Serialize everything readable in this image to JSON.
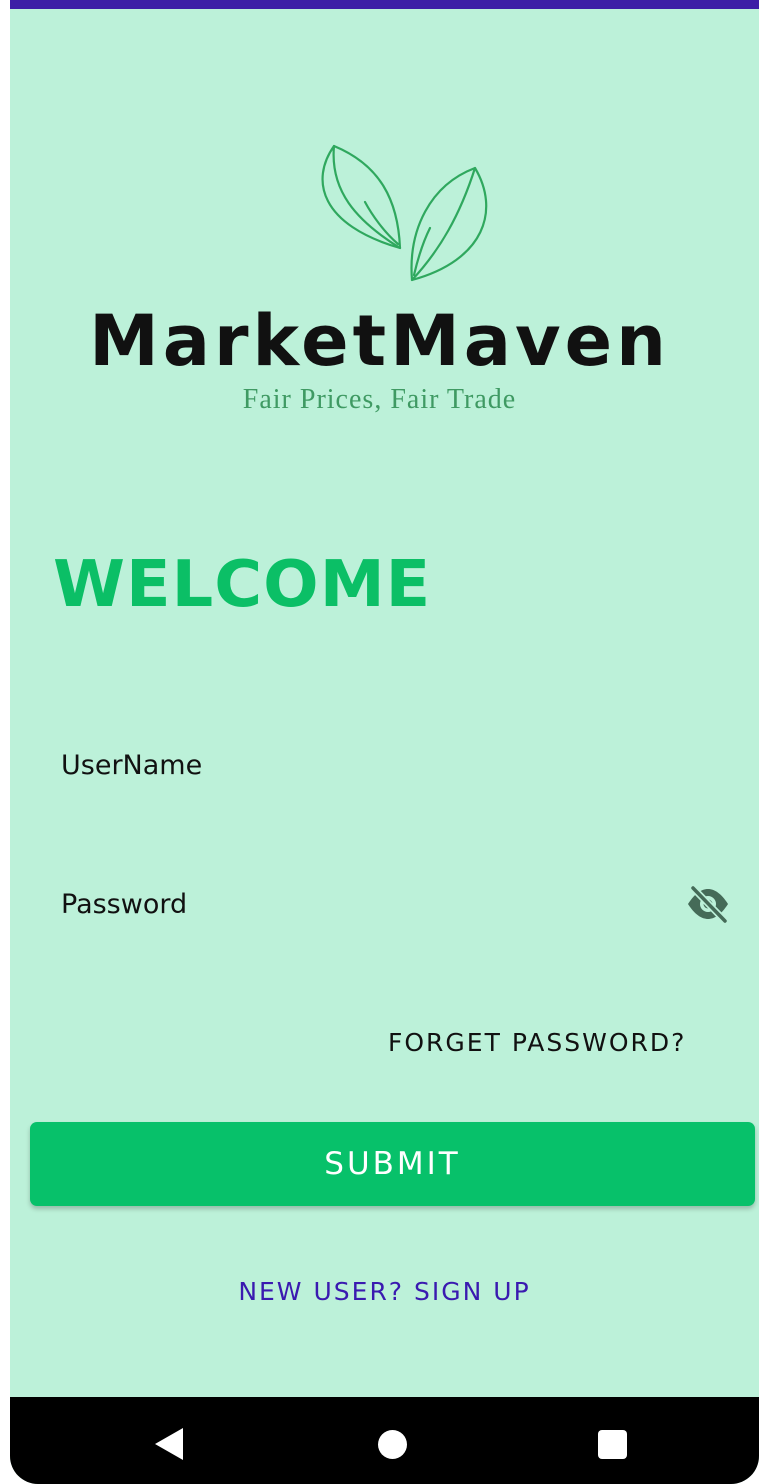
{
  "brand": {
    "name": "MarketMaven",
    "tagline": "Fair Prices, Fair Trade"
  },
  "welcome": "WELCOME",
  "form": {
    "username_placeholder": "UserName",
    "password_placeholder": "Password",
    "forget_password": "FORGET PASSWORD?",
    "submit": "SUBMIT",
    "signup": "NEW USER? SIGN UP"
  },
  "icons": {
    "logo": "leaves-logo-icon",
    "password_toggle": "eye-off-icon",
    "nav_back": "back-triangle-icon",
    "nav_home": "home-circle-icon",
    "nav_recents": "recents-square-icon"
  },
  "colors": {
    "background": "#bcf1d9",
    "accent": "#07c16a",
    "link": "#3a1ab0",
    "status_line": "#3d1fa6",
    "tagline": "#3f9a63"
  }
}
